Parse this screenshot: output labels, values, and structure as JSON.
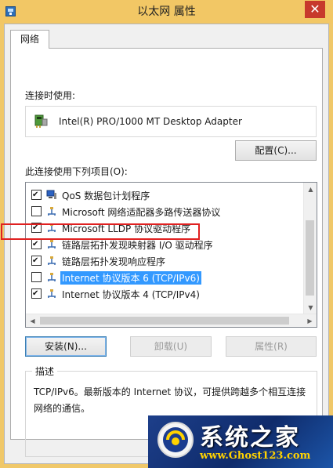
{
  "window": {
    "title": "以太网 属性",
    "close_glyph": "✕"
  },
  "tabs": [
    {
      "label": "网络"
    }
  ],
  "connect_using": {
    "label": "连接时使用:",
    "adapter": "Intel(R) PRO/1000 MT Desktop Adapter",
    "configure_label": "配置(C)..."
  },
  "items_section": {
    "label": "此连接使用下列项目(O):",
    "items": [
      {
        "label": "QoS 数据包计划程序",
        "checked": true,
        "icon": "network-client-icon"
      },
      {
        "label": "Microsoft 网络适配器多路传送器协议",
        "checked": false,
        "icon": "protocol-icon"
      },
      {
        "label": "Microsoft LLDP 协议驱动程序",
        "checked": true,
        "icon": "protocol-icon"
      },
      {
        "label": "链路层拓扑发现映射器 I/O 驱动程序",
        "checked": true,
        "icon": "protocol-icon"
      },
      {
        "label": "链路层拓扑发现响应程序",
        "checked": true,
        "icon": "protocol-icon"
      },
      {
        "label": "Internet 协议版本 6 (TCP/IPv6)",
        "checked": false,
        "selected": true,
        "icon": "protocol-icon"
      },
      {
        "label": "Internet 协议版本 4 (TCP/IPv4)",
        "checked": true,
        "icon": "protocol-icon"
      }
    ]
  },
  "buttons": {
    "install": "安装(N)...",
    "uninstall": "卸载(U)",
    "properties": "属性(R)"
  },
  "description": {
    "legend": "描述",
    "text": "TCP/IPv6。最新版本的 Internet 协议，可提供跨越多个相互连接网络的通信。"
  },
  "watermark": {
    "title": "系统之家",
    "url": "www.Ghost123.com"
  },
  "colors": {
    "titlebar": "#f2c765",
    "close": "#c7392c",
    "selection": "#3399ff",
    "annotation": "#e02020"
  }
}
